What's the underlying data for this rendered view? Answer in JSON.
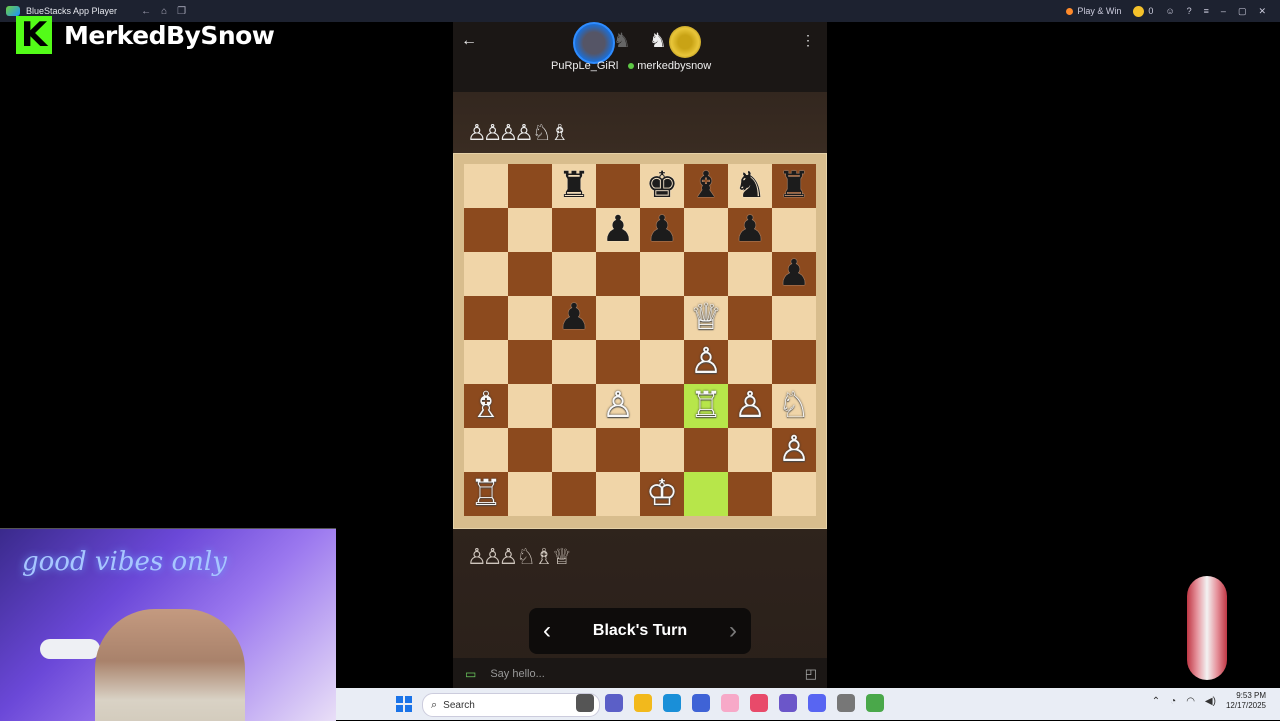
{
  "window": {
    "title": "BlueStacks App Player",
    "play_win_label": "Play & Win",
    "coins": "0"
  },
  "streamer": {
    "logo_letter": "K",
    "name": "MerkedBySnow"
  },
  "game": {
    "players": [
      {
        "name": "PuRpLe_GiRl"
      },
      {
        "name": "merkedbysnow"
      }
    ],
    "captured_top": "♙♙♙♙ ♘ ♗",
    "captured_bottom": "♙♙♙ ♘ ♗ ♕",
    "turn_label": "Black's Turn",
    "prev_arrow": "‹",
    "next_arrow": "›",
    "board": [
      [
        "",
        "",
        "r",
        "",
        "k",
        "b",
        "n",
        "r"
      ],
      [
        "",
        "",
        "",
        "p",
        "p",
        "",
        "p",
        ""
      ],
      [
        "",
        "",
        "",
        "",
        "",
        "",
        "",
        "p"
      ],
      [
        "",
        "",
        "p",
        "",
        "",
        "Q",
        "",
        ""
      ],
      [
        "",
        "",
        "",
        "",
        "",
        "P",
        "",
        ""
      ],
      [
        "B",
        "",
        "",
        "P",
        "",
        "R",
        "P",
        "N"
      ],
      [
        "",
        "",
        "",
        "",
        "",
        "",
        "",
        "P"
      ],
      [
        "R",
        "",
        "",
        "",
        "K",
        "",
        "",
        ""
      ]
    ],
    "highlights": [
      [
        5,
        5
      ],
      [
        7,
        5
      ]
    ]
  },
  "chat": {
    "placeholder": "Say hello..."
  },
  "webcam": {
    "neon_text": "good vibes only"
  },
  "taskbar": {
    "search_label": "Search",
    "time": "9:53 PM",
    "date": "12/17/2025"
  }
}
